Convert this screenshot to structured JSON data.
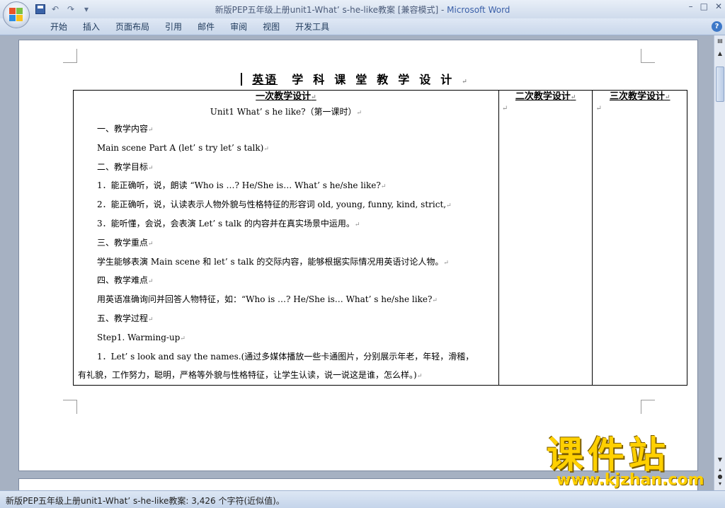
{
  "window": {
    "title_doc": "新版PEP五年级上册unit1-What’ s-he-like教案 [兼容模式] - ",
    "title_app": "Microsoft Word",
    "minimize": "–",
    "restore": "□",
    "close": "✕"
  },
  "quick_access": {
    "undo": "↶",
    "redo": "↷",
    "customize": "▾"
  },
  "ribbon": {
    "tabs": [
      "开始",
      "插入",
      "页面布局",
      "引用",
      "邮件",
      "审阅",
      "视图",
      "开发工具"
    ],
    "help": "?"
  },
  "document": {
    "title_subject": "英语",
    "title_rest": "学科课堂教学设计",
    "para_mark": "↵",
    "col_headers": [
      "一次教学设计",
      "二次教学设计",
      "三次教学设计"
    ],
    "lines": [
      "Unit1  What’ s he like?（第一课时）",
      "一、教学内容",
      "Main scene  Part A (let’ s try  let’ s talk)",
      "二、教学目标",
      "1．能正确听，说，朗读 “Who is …? He/She is… What’ s he/she like?",
      "2．能正确听，说，认读表示人物外貌与性格特征的形容词 old, young, funny, kind, strict,",
      "3．能听懂，会说，会表演 Let’ s talk 的内容并在真实场景中运用。",
      "三、教学重点",
      "学生能够表演 Main scene 和 let’ s talk 的交际内容，能够根据实际情况用英语讨论人物。",
      "四、教学难点",
      "用英语准确询问并回答人物特征，如：“Who is …? He/She is… What’ s he/she like?",
      "五、教学过程",
      "Step1. Warming-up",
      "1．Let’ s look and say the names.(通过多媒体播放一些卡通图片，分别展示年老，年轻，滑稽，",
      "有礼貌，工作努力，聪明，严格等外貌与性格特征，让学生认读，说一说这是谁，怎么样。)"
    ]
  },
  "status": {
    "text": "新版PEP五年级上册unit1-What’ s-he-like教案: 3,426 个字符(近似值)。"
  },
  "watermark": {
    "main": "课件站",
    "url": "www.kjzhan.com"
  },
  "colors": {
    "ribbon_bg": "#cfdbec",
    "page_bg": "#ffffff",
    "doc_area_bg": "#a6b1c2",
    "watermark": "#ffd000"
  }
}
